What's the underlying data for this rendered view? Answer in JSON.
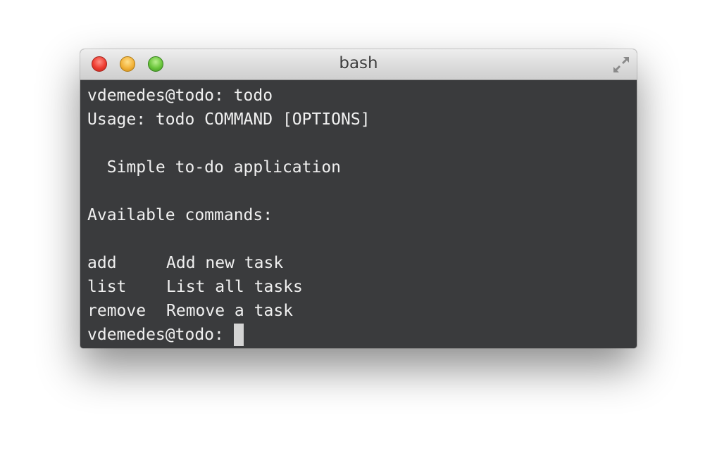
{
  "window": {
    "title": "bash"
  },
  "terminal": {
    "prompt_line_1": "vdemedes@todo: todo",
    "usage": "Usage: todo COMMAND [OPTIONS]",
    "description": "  Simple to-do application",
    "commands_header": "Available commands:",
    "commands": [
      {
        "name": "add",
        "description": "Add new task"
      },
      {
        "name": "list",
        "description": "List all tasks"
      },
      {
        "name": "remove",
        "description": "Remove a task"
      }
    ],
    "prompt_current": "vdemedes@todo:"
  },
  "colors": {
    "terminal_bg": "#3a3b3d",
    "terminal_fg": "#f0f0f0",
    "cursor": "#d4d4d4"
  },
  "icons": {
    "close": "close-button-red",
    "minimize": "minimize-button-yellow",
    "zoom": "zoom-button-green",
    "fullscreen": "fullscreen-arrows-icon"
  }
}
